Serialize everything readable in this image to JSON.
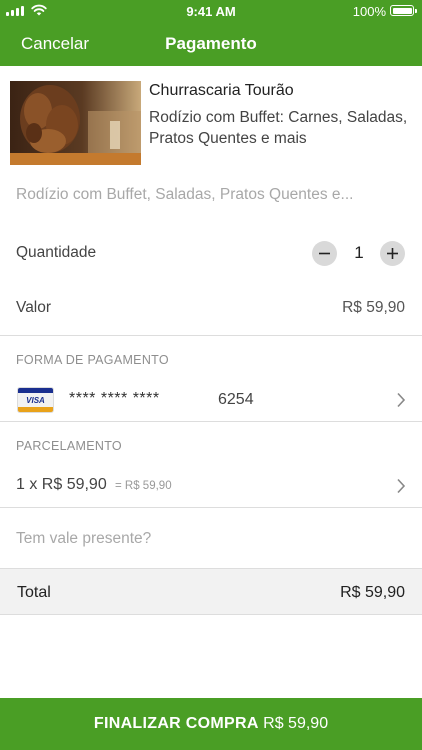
{
  "status_bar": {
    "time": "9:41 AM",
    "battery": "100%"
  },
  "nav": {
    "cancel_label": "Cancelar",
    "title": "Pagamento"
  },
  "product": {
    "name": "Churrascaria Tourão",
    "subtitle": "Rodízio com Buffet: Carnes, Saladas, Pratos Quentes e mais",
    "description": "Rodízio com Buffet, Saladas, Pratos Quentes e..."
  },
  "quantity": {
    "label": "Quantidade",
    "value": "1"
  },
  "price": {
    "label": "Valor",
    "amount": "R$ 59,90"
  },
  "payment": {
    "section_title": "FORMA DE PAGAMENTO",
    "card_brand": "VISA",
    "card_mask": "**** **** ****",
    "card_last4": "6254"
  },
  "installments": {
    "section_title": "PARCELAMENTO",
    "option": "1 x R$ 59,90",
    "total": "= R$ 59,90"
  },
  "gift": {
    "label": "Tem vale presente?"
  },
  "total": {
    "label": "Total",
    "amount": "R$ 59,90"
  },
  "cta": {
    "label": "FINALIZAR COMPRA",
    "amount": "R$ 59,90"
  },
  "colors": {
    "brand_green": "#4a9e25",
    "total_bg": "#f2f2f2"
  }
}
